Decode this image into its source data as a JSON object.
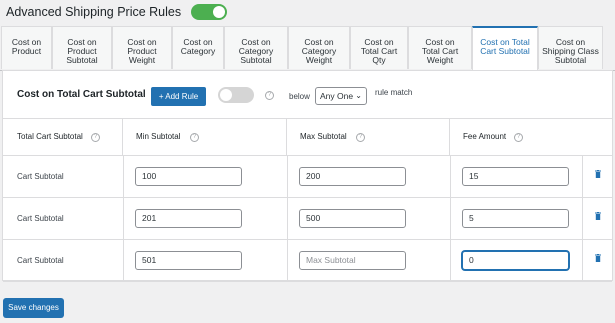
{
  "header": {
    "title": "Advanced Shipping Price Rules"
  },
  "tabs": [
    {
      "lines": [
        "Cost on",
        "Product"
      ]
    },
    {
      "lines": [
        "Cost on",
        "Product",
        "Subtotal"
      ]
    },
    {
      "lines": [
        "Cost on",
        "Product",
        "Weight"
      ]
    },
    {
      "lines": [
        "Cost on",
        "Category"
      ]
    },
    {
      "lines": [
        "Cost on",
        "Category",
        "Subtotal"
      ]
    },
    {
      "lines": [
        "Cost on",
        "Category",
        "Weight"
      ]
    },
    {
      "lines": [
        "Cost on",
        "Total Cart",
        "Qty"
      ]
    },
    {
      "lines": [
        "Cost on",
        "Total Cart",
        "Weight"
      ]
    },
    {
      "lines": [
        "Cost on Total",
        "Cart Subtotal"
      ]
    },
    {
      "lines": [
        "Cost on",
        "Shipping Class",
        "Subtotal"
      ]
    }
  ],
  "panel": {
    "title": "Cost on Total Cart Subtotal",
    "add_rule": "+ Add Rule",
    "below_label": "below",
    "select_value": "Any One",
    "match_label": "rule match"
  },
  "table": {
    "headers": [
      "Total Cart Subtotal",
      "Min Subtotal",
      "Max Subtotal",
      "Fee Amount"
    ],
    "rows": [
      {
        "label": "Cart Subtotal",
        "min": "100",
        "max": "200",
        "fee": "15"
      },
      {
        "label": "Cart Subtotal",
        "min": "201",
        "max": "500",
        "fee": "5"
      },
      {
        "label": "Cart Subtotal",
        "min": "501",
        "max": "",
        "fee": "0"
      }
    ],
    "max_placeholder": "Max Subtotal"
  },
  "footer": {
    "save": "Save changes"
  },
  "colors": {
    "accent": "#2271b1",
    "toggle_on": "#4caf50",
    "delete": "#2271b1"
  }
}
